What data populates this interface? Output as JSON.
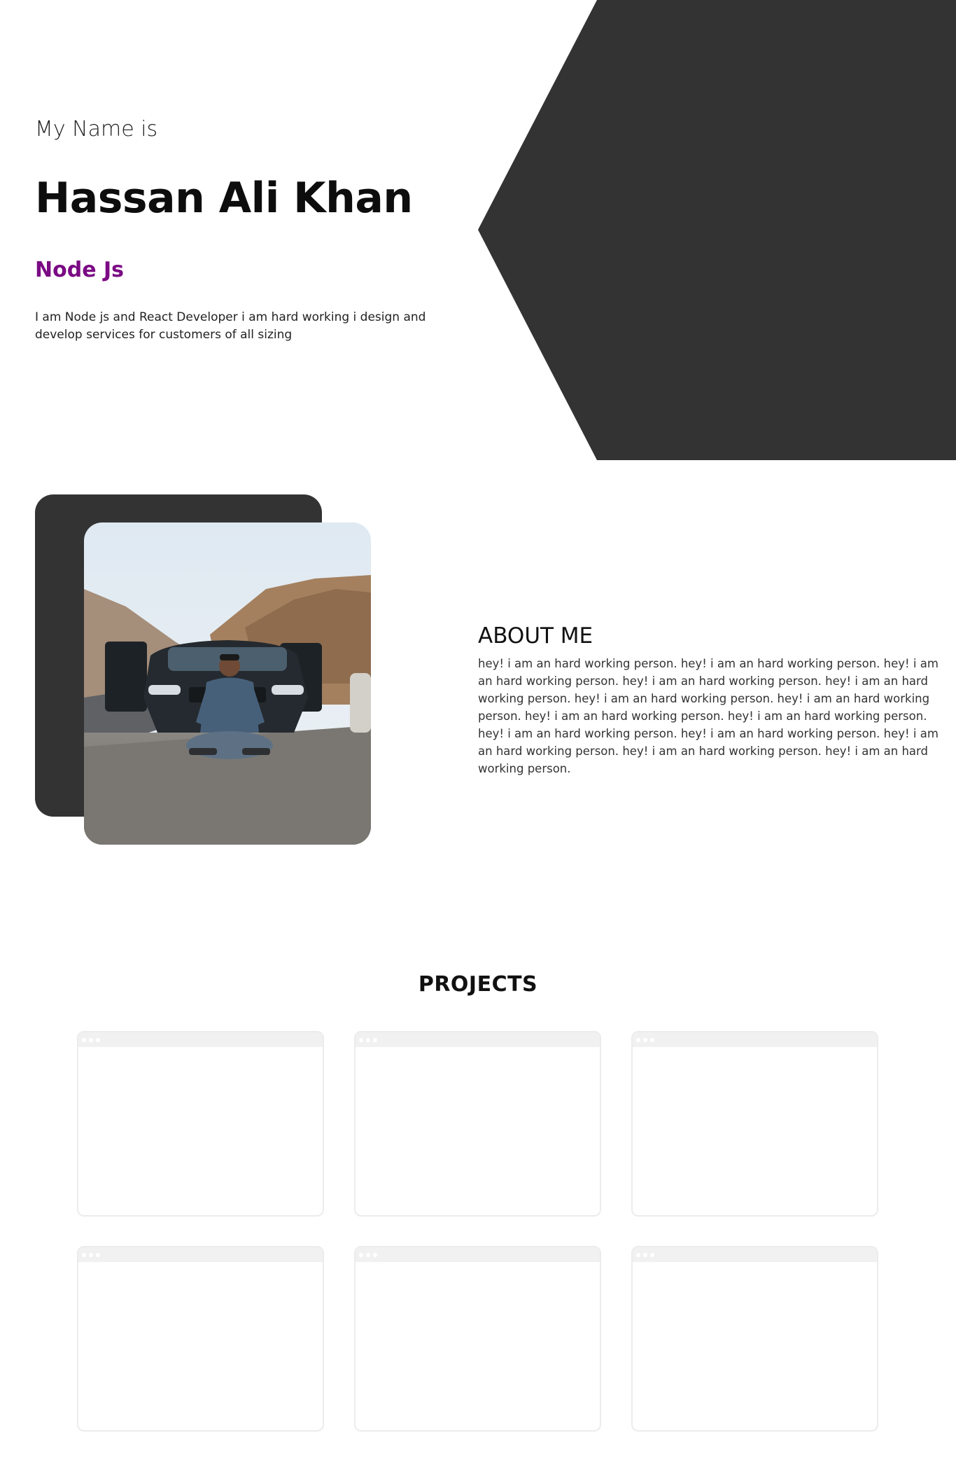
{
  "hero": {
    "intro_label": "My Name is",
    "name": "Hassan Ali Khan",
    "role": "Node Js",
    "bio": "I am Node js and React Developer i am hard working i design and develop services for customers of all sizing"
  },
  "about": {
    "title": "ABOUT ME",
    "text": "hey! i am an hard working person. hey! i am an hard working person. hey! i am an hard working person. hey! i am an hard working person. hey! i am an hard working person. hey! i am an hard working person. hey! i am an hard working person. hey! i am an hard working person. hey! i am an hard working person. hey! i am an hard working person. hey! i am an hard working person. hey! i am an hard working person. hey! i am an hard working person. hey! i am an hard working person."
  },
  "projects": {
    "title": "PROJECTS",
    "cards": [
      {},
      {},
      {},
      {},
      {},
      {}
    ]
  },
  "colors": {
    "accent": "#7b0a84",
    "dark": "#333333"
  }
}
